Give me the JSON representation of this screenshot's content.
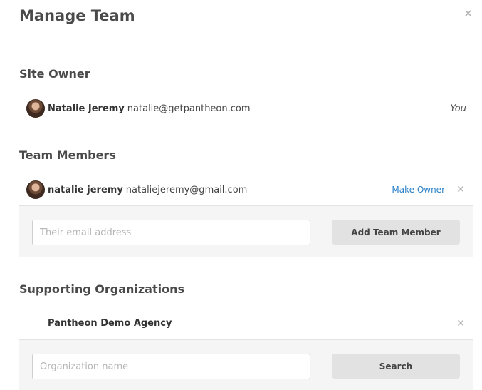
{
  "modal": {
    "title": "Manage Team",
    "close_icon": "close-icon"
  },
  "site_owner": {
    "heading": "Site Owner",
    "name": "Natalie Jeremy",
    "email": "natalie@getpantheon.com",
    "you_label": "You"
  },
  "team_members": {
    "heading": "Team Members",
    "members": [
      {
        "name": "natalie jeremy",
        "email": "nataliejeremy@gmail.com",
        "action_label": "Make Owner"
      }
    ],
    "add_form": {
      "placeholder": "Their email address",
      "button_label": "Add Team Member"
    }
  },
  "supporting_organizations": {
    "heading": "Supporting Organizations",
    "organizations": [
      {
        "name": "Pantheon Demo Agency"
      }
    ],
    "search_form": {
      "placeholder": "Organization name",
      "button_label": "Search"
    }
  },
  "colors": {
    "link": "#2a80c7",
    "panel_bg": "#f5f5f5",
    "button_bg": "#e2e2e2"
  }
}
